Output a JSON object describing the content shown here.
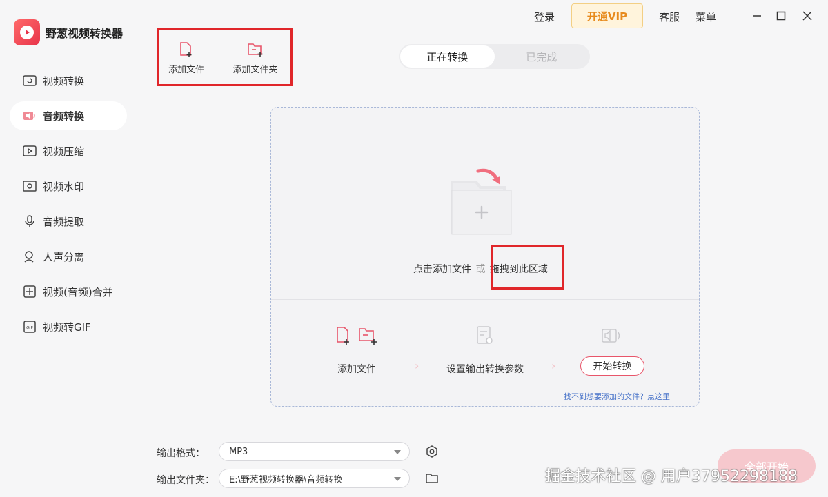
{
  "app": {
    "name": "野葱视频转换器"
  },
  "titlebar": {
    "login": "登录",
    "vip": "开通VIP",
    "support": "客服",
    "menu": "菜单"
  },
  "sidebar": {
    "items": [
      {
        "label": "视频转换",
        "icon": "video-convert-icon"
      },
      {
        "label": "音频转换",
        "icon": "audio-convert-icon",
        "active": true
      },
      {
        "label": "视频压缩",
        "icon": "video-compress-icon"
      },
      {
        "label": "视频水印",
        "icon": "video-watermark-icon"
      },
      {
        "label": "音频提取",
        "icon": "audio-extract-icon"
      },
      {
        "label": "人声分离",
        "icon": "vocal-separate-icon"
      },
      {
        "label": "视频(音频)合并",
        "icon": "merge-icon"
      },
      {
        "label": "视频转GIF",
        "icon": "gif-icon"
      }
    ]
  },
  "toolbar": {
    "add_file": "添加文件",
    "add_folder": "添加文件夹"
  },
  "tabs": {
    "converting": "正在转换",
    "completed": "已完成"
  },
  "dropzone": {
    "hint_click": "点击添加文件",
    "hint_or": "或",
    "hint_drag": "拖拽到此区域",
    "step1": "添加文件",
    "step2": "设置输出转换参数",
    "step3": "开始转换",
    "help": "找不到想要添加的文件？点这里"
  },
  "output": {
    "format_label": "输出格式：",
    "format_value": "MP3",
    "folder_label": "输出文件夹：",
    "folder_value": "E:\\野葱视频转换器\\音频转换"
  },
  "convert_all": "全部开始",
  "watermark": "掘金技术社区 @ 用户37952298188",
  "colors": {
    "accent": "#e8344a",
    "vip": "#e78a1c",
    "highlight_box": "#e0262a"
  }
}
